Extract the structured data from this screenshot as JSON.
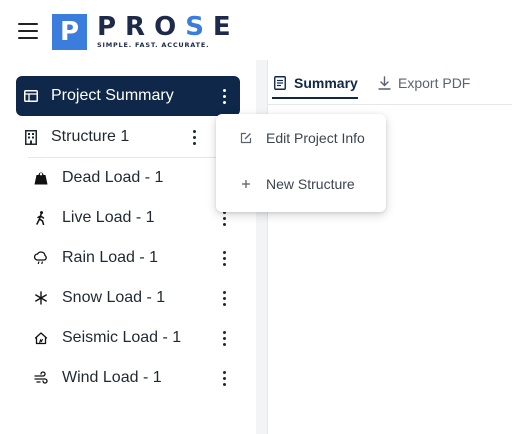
{
  "app": {
    "logo_letter": "P",
    "logo_word_a": "PRO",
    "logo_word_b": "S",
    "logo_word_c": "E",
    "logo_tagline": "SIMPLE. FAST. ACCURATE.",
    "brand_color": "#3b7ddd",
    "navy_color": "#0f2748"
  },
  "sidebar": {
    "project_summary": {
      "label": "Project Summary",
      "icon": "table-icon"
    },
    "structure": {
      "label": "Structure 1",
      "icon": "building-icon"
    },
    "loads": [
      {
        "label": "Dead Load - 1",
        "icon": "weight-icon"
      },
      {
        "label": "Live Load - 1",
        "icon": "person-walking-icon"
      },
      {
        "label": "Rain Load - 1",
        "icon": "cloud-rain-icon"
      },
      {
        "label": "Snow Load - 1",
        "icon": "snowflake-icon"
      },
      {
        "label": "Seismic Load - 1",
        "icon": "house-seismic-icon"
      },
      {
        "label": "Wind Load - 1",
        "icon": "wind-icon"
      }
    ]
  },
  "tabs": [
    {
      "label": "Summary",
      "icon": "document-icon",
      "active": true
    },
    {
      "label": "Export PDF",
      "icon": "download-icon",
      "active": false
    }
  ],
  "context_menu": [
    {
      "label": "Edit Project Info",
      "icon": "edit-icon"
    },
    {
      "label": "New Structure",
      "icon": "plus-icon"
    }
  ]
}
